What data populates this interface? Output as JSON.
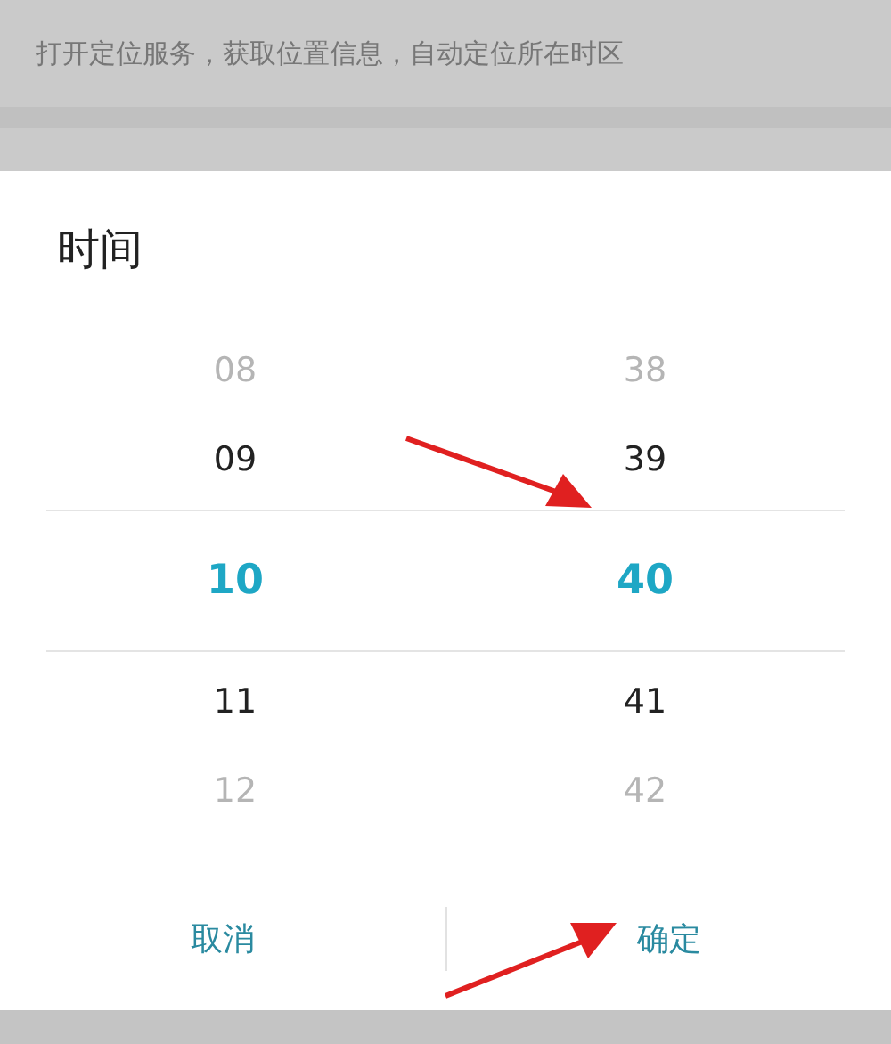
{
  "settings": {
    "description": "打开定位服务，获取位置信息，自动定位所在时区"
  },
  "dialog": {
    "title": "时间",
    "hours": [
      {
        "value": "08",
        "selected": false
      },
      {
        "value": "09",
        "selected": false
      },
      {
        "value": "10",
        "selected": true
      },
      {
        "value": "11",
        "selected": false
      },
      {
        "value": "12",
        "selected": false
      }
    ],
    "minutes": [
      {
        "value": "38",
        "selected": false
      },
      {
        "value": "39",
        "selected": false
      },
      {
        "value": "40",
        "selected": true
      },
      {
        "value": "41",
        "selected": false
      },
      {
        "value": "42",
        "selected": false
      }
    ],
    "buttons": [
      "取消",
      "确定"
    ]
  }
}
